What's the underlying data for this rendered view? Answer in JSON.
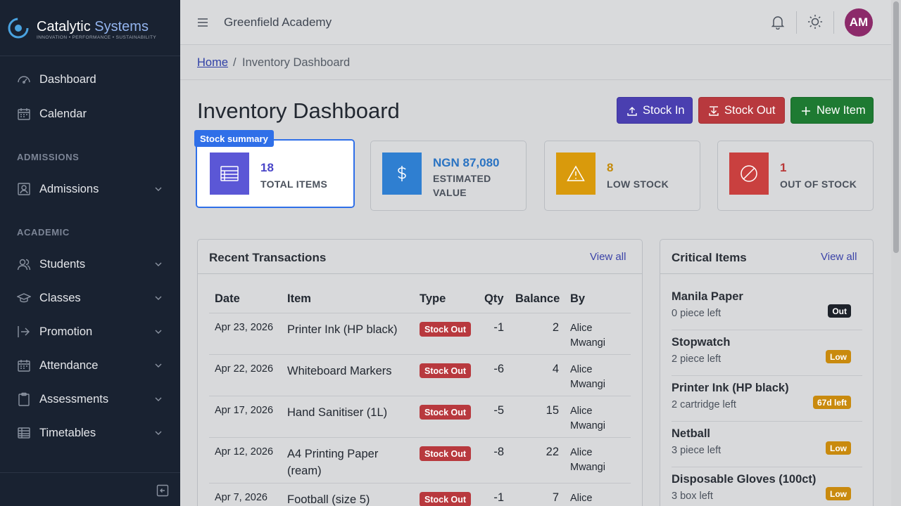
{
  "brand": {
    "name_part1": "Catalytic",
    "name_part2": "Systems",
    "tagline": "INNOVATION • PERFORMANCE • SUSTAINABILITY"
  },
  "sidebar": {
    "items": [
      {
        "label": "Dashboard",
        "icon": "gauge-icon"
      },
      {
        "label": "Calendar",
        "icon": "calendar-icon"
      }
    ],
    "sections": [
      {
        "title": "ADMISSIONS",
        "items": [
          {
            "label": "Admissions",
            "icon": "id-card-icon"
          }
        ]
      },
      {
        "title": "ACADEMIC",
        "items": [
          {
            "label": "Students",
            "icon": "users-icon"
          },
          {
            "label": "Classes",
            "icon": "graduation-cap-icon"
          },
          {
            "label": "Promotion",
            "icon": "arrow-right-icon"
          },
          {
            "label": "Attendance",
            "icon": "calendar-check-icon"
          },
          {
            "label": "Assessments",
            "icon": "clipboard-icon"
          },
          {
            "label": "Timetables",
            "icon": "table-icon"
          }
        ]
      }
    ]
  },
  "topbar": {
    "school": "Greenfield Academy",
    "avatar_initials": "AM"
  },
  "breadcrumb": {
    "home": "Home",
    "separator": "/",
    "current": "Inventory Dashboard"
  },
  "page": {
    "title": "Inventory Dashboard",
    "actions": {
      "stock_in": "Stock In",
      "stock_out": "Stock Out",
      "new_item": "New Item"
    }
  },
  "highlight_tag": "Stock summary",
  "stats": [
    {
      "value": "18",
      "label": "TOTAL ITEMS",
      "color": "#5b57d6"
    },
    {
      "value": "NGN 87,080",
      "label": "ESTIMATED VALUE",
      "color": "#2f7fd1"
    },
    {
      "value": "8",
      "label": "LOW STOCK",
      "color": "#d99a0c"
    },
    {
      "value": "1",
      "label": "OUT OF STOCK",
      "color": "#c9403f"
    }
  ],
  "transactions": {
    "title": "Recent Transactions",
    "view_all": "View all",
    "columns": [
      "Date",
      "Item",
      "Type",
      "Qty",
      "Balance",
      "By"
    ],
    "rows": [
      {
        "date": "Apr 23, 2026",
        "item": "Printer Ink (HP black)",
        "type": "Stock Out",
        "qty": "-1",
        "balance": "2",
        "by": "Alice Mwangi"
      },
      {
        "date": "Apr 22, 2026",
        "item": "Whiteboard Markers",
        "type": "Stock Out",
        "qty": "-6",
        "balance": "4",
        "by": "Alice Mwangi"
      },
      {
        "date": "Apr 17, 2026",
        "item": "Hand Sanitiser (1L)",
        "type": "Stock Out",
        "qty": "-5",
        "balance": "15",
        "by": "Alice Mwangi"
      },
      {
        "date": "Apr 12, 2026",
        "item": "A4 Printing Paper (ream)",
        "type": "Stock Out",
        "qty": "-8",
        "balance": "22",
        "by": "Alice Mwangi"
      },
      {
        "date": "Apr 7, 2026",
        "item": "Football (size 5)",
        "type": "Stock Out",
        "qty": "-1",
        "balance": "7",
        "by": "Alice"
      }
    ]
  },
  "critical": {
    "title": "Critical Items",
    "view_all": "View all",
    "items": [
      {
        "name": "Manila Paper",
        "left": "0 piece left",
        "badge": "Out",
        "kind": "out"
      },
      {
        "name": "Stopwatch",
        "left": "2 piece left",
        "badge": "Low",
        "kind": "low"
      },
      {
        "name": "Printer Ink (HP black)",
        "left": "2 cartridge left",
        "badge": "67d left",
        "kind": "low"
      },
      {
        "name": "Netball",
        "left": "3 piece left",
        "badge": "Low",
        "kind": "low"
      },
      {
        "name": "Disposable Gloves (100ct)",
        "left": "3 box left",
        "badge": "Low",
        "kind": "low"
      }
    ]
  }
}
